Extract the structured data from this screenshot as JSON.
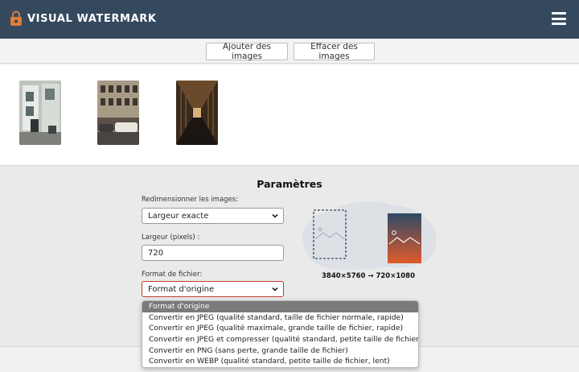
{
  "header": {
    "brand": "VISUAL WATERMARK",
    "logo_icon": "lock-icon",
    "menu_icon": "hamburger-menu-icon",
    "bg_color": "#34495e"
  },
  "toolbar": {
    "add_images_label": "Ajouter des images",
    "clear_images_label": "Effacer des images"
  },
  "gallery": {
    "thumbnails": [
      {
        "name": "building-photo"
      },
      {
        "name": "street-photo"
      },
      {
        "name": "hallway-photo"
      }
    ]
  },
  "settings": {
    "title": "Paramètres",
    "resize_label": "Redimensionner les images:",
    "resize_value": "Largeur exacte",
    "width_label": "Largeur (pixels) :",
    "width_value": "720",
    "format_label": "Format de fichier:",
    "format_value": "Format d'origine",
    "dimensions_text": "3840×5760 → 720×1080"
  },
  "dropdown": {
    "options": [
      "Format d'origine",
      "Convertir en JPEG (qualité standard, taille de fichier normale, rapide)",
      "Convertir en JPEG (qualité maximale, grande taille de fichier, rapide)",
      "Convertir en JPEG et compresser (qualité standard, petite taille de fichier, lent)",
      "Convertir en PNG (sans perte, grande taille de fichier)",
      "Convertir en WEBP (qualité standard, petite taille de fichier, lent)"
    ],
    "selected_index": 0
  }
}
